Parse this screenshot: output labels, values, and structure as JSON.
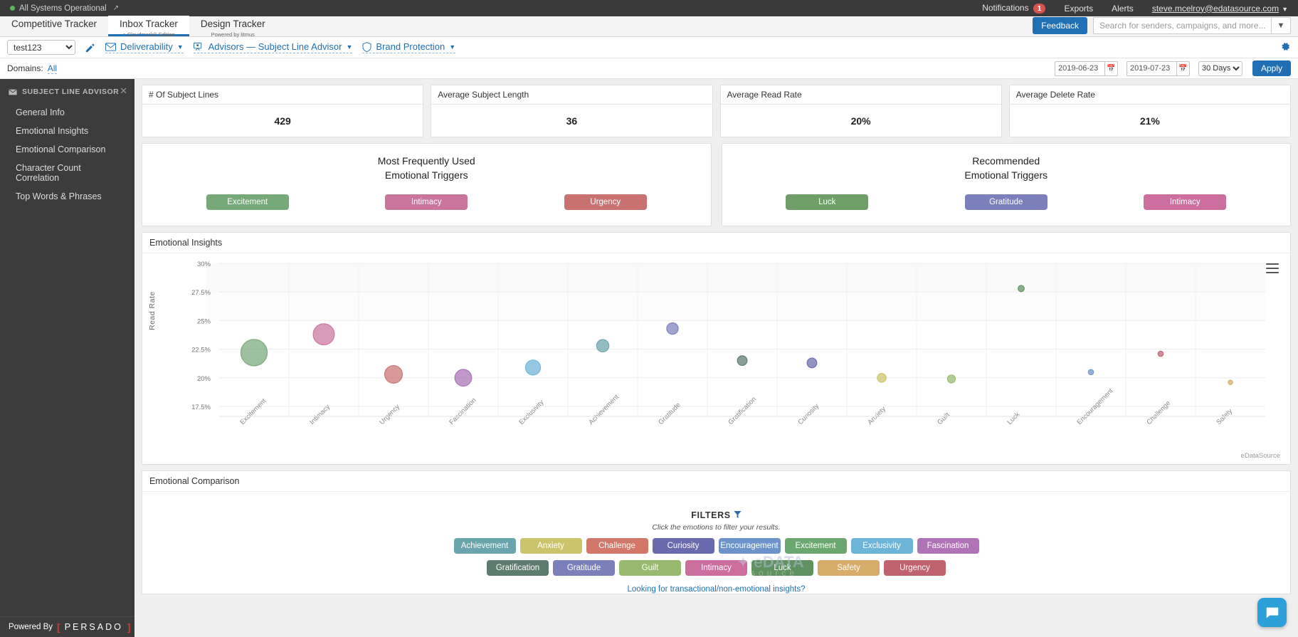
{
  "statusbar": {
    "status_text": "All Systems Operational",
    "notifications_label": "Notifications",
    "notifications_count": "1",
    "exports_label": "Exports",
    "alerts_label": "Alerts",
    "user_email": "steve.mcelroy@edatasource.com"
  },
  "tabs": [
    {
      "label": "Competitive Tracker",
      "sub": ""
    },
    {
      "label": "Inbox Tracker",
      "sub": "Cloudmark® Edition"
    },
    {
      "label": "Design Tracker",
      "sub": "Powered by litmus"
    }
  ],
  "tabbar": {
    "feedback_label": "Feedback",
    "search_placeholder": "Search for senders, campaigns, and more..."
  },
  "toolbar": {
    "account_value": "test123",
    "deliverability_label": "Deliverability",
    "advisors_label": "Advisors — Subject Line Advisor",
    "brand_protection_label": "Brand Protection"
  },
  "domainbar": {
    "domains_label": "Domains:",
    "domains_value": "All",
    "date_start": "2019-06-23",
    "date_end": "2019-07-23",
    "range_value": "30 Days",
    "apply_label": "Apply"
  },
  "sidebar": {
    "header": "SUBJECT LINE ADVISOR",
    "items": [
      {
        "label": "General Info"
      },
      {
        "label": "Emotional Insights"
      },
      {
        "label": "Emotional Comparison"
      },
      {
        "label": "Character Count Correlation"
      },
      {
        "label": "Top Words & Phrases"
      }
    ],
    "powered_by": "Powered By",
    "brand": "PERSADO"
  },
  "kpis": [
    {
      "title": "# Of Subject Lines",
      "value": "429"
    },
    {
      "title": "Average Subject Length",
      "value": "36"
    },
    {
      "title": "Average Read Rate",
      "value": "20%"
    },
    {
      "title": "Average Delete Rate",
      "value": "21%"
    }
  ],
  "triggers": {
    "most_used": {
      "line1": "Most Frequently Used",
      "line2": "Emotional Triggers",
      "badges": [
        {
          "label": "Excitement",
          "color": "#77a878"
        },
        {
          "label": "Intimacy",
          "color": "#c9759e"
        },
        {
          "label": "Urgency",
          "color": "#c97272"
        }
      ]
    },
    "recommended": {
      "line1": "Recommended",
      "line2": "Emotional Triggers",
      "badges": [
        {
          "label": "Luck",
          "color": "#6f9e68"
        },
        {
          "label": "Gratitude",
          "color": "#7b7fba"
        },
        {
          "label": "Intimacy",
          "color": "#cc6f9e"
        }
      ]
    }
  },
  "insights_panel": {
    "title": "Emotional Insights",
    "credit": "eDataSource"
  },
  "comparison_panel": {
    "title": "Emotional Comparison",
    "filters_title": "FILTERS",
    "filters_sub": "Click the emotions to filter your results.",
    "transactional_link": "Looking for transactional/non-emotional insights?",
    "filters_row1": [
      {
        "label": "Achievement",
        "color": "#6aa4ac"
      },
      {
        "label": "Anxiety",
        "color": "#ccc46c"
      },
      {
        "label": "Challenge",
        "color": "#d2776a"
      },
      {
        "label": "Curiosity",
        "color": "#6a6aae"
      },
      {
        "label": "Encouragement",
        "color": "#6d93ca"
      },
      {
        "label": "Excitement",
        "color": "#6aa86f"
      },
      {
        "label": "Exclusivity",
        "color": "#6cb4d8"
      },
      {
        "label": "Fascination",
        "color": "#b073b5"
      }
    ],
    "filters_row2": [
      {
        "label": "Gratification",
        "color": "#5d7b6e"
      },
      {
        "label": "Gratitude",
        "color": "#7b7fba"
      },
      {
        "label": "Guilt",
        "color": "#97ba6e"
      },
      {
        "label": "Intimacy",
        "color": "#cc6f9e"
      },
      {
        "label": "Luck",
        "color": "#5f9161"
      },
      {
        "label": "Safety",
        "color": "#d7ab69"
      },
      {
        "label": "Urgency",
        "color": "#c1636f"
      }
    ]
  },
  "chart_data": {
    "type": "scatter",
    "title": "Emotional Insights",
    "xlabel": "",
    "ylabel": "Read Rate",
    "ylim": [
      17.5,
      30
    ],
    "ytick_labels": [
      "30%",
      "27.5%",
      "25%",
      "22.5%",
      "20%",
      "17.5%"
    ],
    "ytick_values": [
      30,
      27.5,
      25,
      22.5,
      20,
      17.5
    ],
    "grid": true,
    "legend": false,
    "categories": [
      "Excitement",
      "Intimacy",
      "Urgency",
      "Fascination",
      "Exclusivity",
      "Achievement",
      "Gratitude",
      "Gratification",
      "Curiosity",
      "Anxiety",
      "Guilt",
      "Luck",
      "Encouragement",
      "Challenge",
      "Safety"
    ],
    "points": [
      {
        "x": "Excitement",
        "y": 22.2,
        "size": 30,
        "color": "#77a878"
      },
      {
        "x": "Intimacy",
        "y": 23.8,
        "size": 24,
        "color": "#c9759e"
      },
      {
        "x": "Urgency",
        "y": 20.3,
        "size": 20,
        "color": "#c97272"
      },
      {
        "x": "Fascination",
        "y": 20.0,
        "size": 19,
        "color": "#a870b5"
      },
      {
        "x": "Exclusivity",
        "y": 20.9,
        "size": 17,
        "color": "#6cb4d8"
      },
      {
        "x": "Achievement",
        "y": 22.8,
        "size": 14,
        "color": "#6aa4ac"
      },
      {
        "x": "Gratitude",
        "y": 24.3,
        "size": 13,
        "color": "#7b7fba"
      },
      {
        "x": "Gratification",
        "y": 21.5,
        "size": 11,
        "color": "#5d7b6e"
      },
      {
        "x": "Curiosity",
        "y": 21.3,
        "size": 11,
        "color": "#6a6aae"
      },
      {
        "x": "Anxiety",
        "y": 20.0,
        "size": 10,
        "color": "#ccc46c"
      },
      {
        "x": "Guilt",
        "y": 19.9,
        "size": 9,
        "color": "#97ba6e"
      },
      {
        "x": "Luck",
        "y": 27.8,
        "size": 7,
        "color": "#5f9161"
      },
      {
        "x": "Encouragement",
        "y": 20.5,
        "size": 6,
        "color": "#6d93ca"
      },
      {
        "x": "Challenge",
        "y": 22.1,
        "size": 6,
        "color": "#c1636f"
      },
      {
        "x": "Safety",
        "y": 19.6,
        "size": 5,
        "color": "#d7ab69"
      }
    ]
  }
}
